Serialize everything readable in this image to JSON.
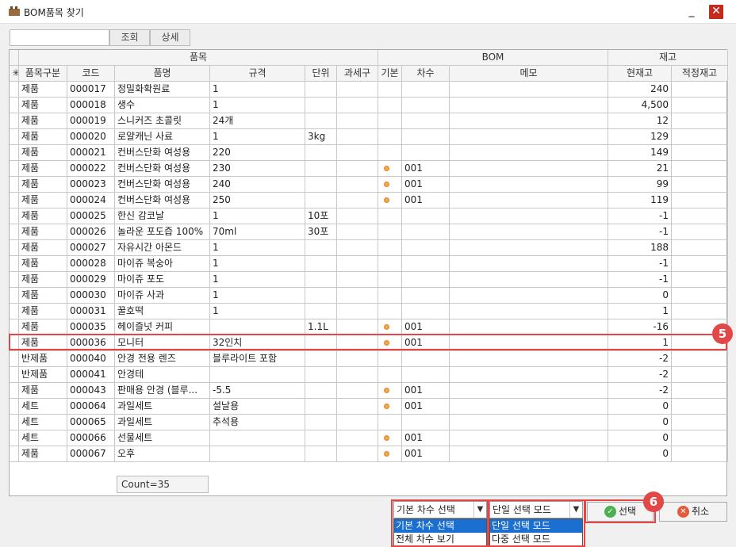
{
  "window": {
    "title": "BOM품목 찾기",
    "minimize": "_",
    "close": "✕"
  },
  "toolbar": {
    "search_label": "조회",
    "detail_label": "상세"
  },
  "grid": {
    "groups": {
      "item": "품목",
      "bom": "BOM",
      "stock": "재고"
    },
    "columns": {
      "marker": "✳",
      "category": "품목구분",
      "code": "코드",
      "name": "품명",
      "spec": "규격",
      "unit": "단위",
      "tax": "과세구",
      "base": "기본",
      "rev": "차수",
      "memo": "메모",
      "current": "현재고",
      "safety": "적정재고"
    },
    "rows": [
      {
        "category": "제품",
        "code": "000017",
        "name": "정밀화확원료",
        "spec": "1",
        "unit": "",
        "base": false,
        "rev": "",
        "current": "240"
      },
      {
        "category": "제품",
        "code": "000018",
        "name": "생수",
        "spec": "1",
        "unit": "",
        "base": false,
        "rev": "",
        "current": "4,500"
      },
      {
        "category": "제품",
        "code": "000019",
        "name": "스니커즈 초콜릿",
        "spec": "24개",
        "unit": "",
        "base": false,
        "rev": "",
        "current": "12"
      },
      {
        "category": "제품",
        "code": "000020",
        "name": "로얄캐닌 사료",
        "spec": "1",
        "unit": "3kg",
        "base": false,
        "rev": "",
        "current": "129"
      },
      {
        "category": "제품",
        "code": "000021",
        "name": "컨버스단화 여성용",
        "spec": "220",
        "unit": "",
        "base": false,
        "rev": "",
        "current": "149"
      },
      {
        "category": "제품",
        "code": "000022",
        "name": "컨버스단화 여성용",
        "spec": "230",
        "unit": "",
        "base": true,
        "rev": "001",
        "current": "21"
      },
      {
        "category": "제품",
        "code": "000023",
        "name": "컨버스단화 여성용",
        "spec": "240",
        "unit": "",
        "base": true,
        "rev": "001",
        "current": "99"
      },
      {
        "category": "제품",
        "code": "000024",
        "name": "컨버스단화 여성용",
        "spec": "250",
        "unit": "",
        "base": true,
        "rev": "001",
        "current": "119"
      },
      {
        "category": "제품",
        "code": "000025",
        "name": "한신 감코날",
        "spec": "1",
        "unit": "10포",
        "base": false,
        "rev": "",
        "current": "-1"
      },
      {
        "category": "제품",
        "code": "000026",
        "name": "놀라운 포도즙 100%",
        "spec": "70ml",
        "unit": "30포",
        "base": false,
        "rev": "",
        "current": "-1"
      },
      {
        "category": "제품",
        "code": "000027",
        "name": "자유시간 아몬드",
        "spec": "1",
        "unit": "",
        "base": false,
        "rev": "",
        "current": "188"
      },
      {
        "category": "제품",
        "code": "000028",
        "name": "마이쥬 복숭아",
        "spec": "1",
        "unit": "",
        "base": false,
        "rev": "",
        "current": "-1"
      },
      {
        "category": "제품",
        "code": "000029",
        "name": "마이쥬 포도",
        "spec": "1",
        "unit": "",
        "base": false,
        "rev": "",
        "current": "-1"
      },
      {
        "category": "제품",
        "code": "000030",
        "name": "마이쥬 사과",
        "spec": "1",
        "unit": "",
        "base": false,
        "rev": "",
        "current": "0"
      },
      {
        "category": "제품",
        "code": "000031",
        "name": "꿀호떡",
        "spec": "1",
        "unit": "",
        "base": false,
        "rev": "",
        "current": "1"
      },
      {
        "category": "제품",
        "code": "000035",
        "name": "헤이즐넛 커피",
        "spec": "",
        "unit": "1.1L",
        "base": true,
        "rev": "001",
        "current": "-16"
      },
      {
        "category": "제품",
        "code": "000036",
        "name": "모니터",
        "spec": "32인치",
        "unit": "",
        "base": true,
        "rev": "001",
        "current": "1"
      },
      {
        "category": "반제품",
        "code": "000040",
        "name": "안경 전용 렌즈",
        "spec": "블루라이트 포함",
        "unit": "",
        "base": false,
        "rev": "",
        "current": "-2"
      },
      {
        "category": "반제품",
        "code": "000041",
        "name": "안경테",
        "spec": "",
        "unit": "",
        "base": false,
        "rev": "",
        "current": "-2"
      },
      {
        "category": "제품",
        "code": "000043",
        "name": "판매용 안경 (블루...",
        "spec": "-5.5",
        "unit": "",
        "base": true,
        "rev": "001",
        "current": "-2"
      },
      {
        "category": "세트",
        "code": "000064",
        "name": "과일세트",
        "spec": "설날용",
        "unit": "",
        "base": true,
        "rev": "001",
        "current": "0"
      },
      {
        "category": "세트",
        "code": "000065",
        "name": "과일세트",
        "spec": "추석용",
        "unit": "",
        "base": false,
        "rev": "",
        "current": "0"
      },
      {
        "category": "세트",
        "code": "000066",
        "name": "선물세트",
        "spec": "",
        "unit": "",
        "base": true,
        "rev": "001",
        "current": "0"
      },
      {
        "category": "제품",
        "code": "000067",
        "name": "오후",
        "spec": "",
        "unit": "",
        "base": true,
        "rev": "001",
        "current": "0"
      }
    ],
    "count_text": "Count=35"
  },
  "footer": {
    "rev_combo": {
      "value": "기본 차수 선택",
      "options": [
        "기본 차수 선택",
        "전체 차수 보기"
      ]
    },
    "mode_combo": {
      "value": "단일 선택 모드",
      "options": [
        "단일 선택 모드",
        "다중 선택 모드"
      ]
    },
    "select_label": "선택",
    "cancel_label": "취소"
  },
  "annotations": {
    "badge_row": "5",
    "badge_button": "6"
  },
  "colors": {
    "accent_red": "#e64545",
    "dropdown_highlight": "#1a6fd0",
    "dot_orange": "#f0a64c"
  }
}
